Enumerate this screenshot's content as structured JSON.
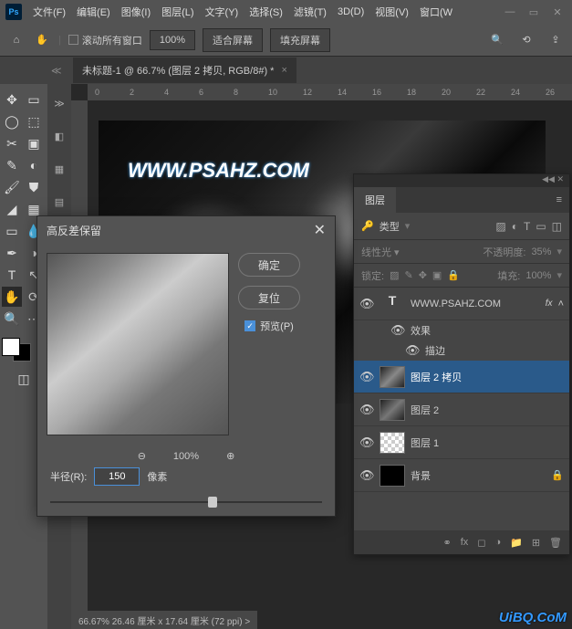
{
  "menu": {
    "items": [
      "文件(F)",
      "编辑(E)",
      "图像(I)",
      "图层(L)",
      "文字(Y)",
      "选择(S)",
      "滤镜(T)",
      "3D(D)",
      "视图(V)",
      "窗口(W"
    ]
  },
  "options": {
    "scroll_label": "滚动所有窗口",
    "zoom": "100%",
    "fit_screen": "适合屏幕",
    "fill_screen": "填充屏幕"
  },
  "tab": {
    "title": "未标题-1 @ 66.7% (图层 2 拷贝, RGB/8#) *"
  },
  "ruler": {
    "marks": [
      "0",
      "2",
      "4",
      "6",
      "8",
      "10",
      "12",
      "14",
      "16",
      "18",
      "20",
      "22",
      "24",
      "26"
    ]
  },
  "canvas": {
    "watermark": "WWW.PSAHZ.COM"
  },
  "dialog": {
    "title": "高反差保留",
    "ok": "确定",
    "cancel": "复位",
    "preview": "预览(P)",
    "zoom": "100%",
    "radius_label": "半径(R):",
    "radius_value": "150",
    "unit": "像素"
  },
  "panel": {
    "tab": "图层",
    "kind": "类型",
    "blend_mode": "线性光",
    "opacity_label": "不透明度:",
    "opacity_value": "35%",
    "lock_label": "锁定:",
    "fill_label": "填充:",
    "fill_value": "100%",
    "layers": [
      {
        "type": "text",
        "name": "WWW.PSAHZ.COM",
        "fx": "fx"
      },
      {
        "type": "fx_sub",
        "name": "效果"
      },
      {
        "type": "fx_sub2",
        "name": "描边"
      },
      {
        "type": "normal",
        "name": "图层 2 拷贝",
        "selected": true
      },
      {
        "type": "normal",
        "name": "图层 2"
      },
      {
        "type": "checker",
        "name": "图层 1"
      },
      {
        "type": "bg",
        "name": "背景",
        "locked": true
      }
    ]
  },
  "status": "66.67%   26.46 厘米 x 17.64 厘米 (72 ppi)   >",
  "brand": "UiBQ.CoM"
}
